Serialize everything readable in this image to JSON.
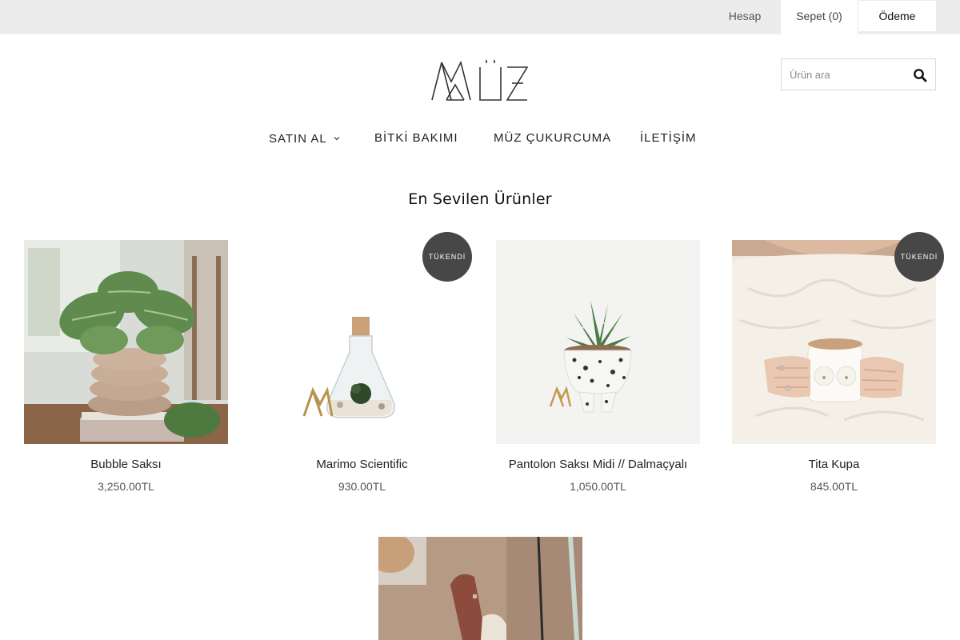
{
  "topbar": {
    "account": "Hesap",
    "cart": "Sepet (0)",
    "checkout": "Ödeme"
  },
  "logo": {
    "text": "MÜZ"
  },
  "search": {
    "placeholder": "Ürün ara",
    "value": ""
  },
  "nav": {
    "items": [
      {
        "label": "SATIN AL",
        "has_dropdown": true
      },
      {
        "label": "BİTKİ BAKIMI"
      },
      {
        "label": "MÜZ ÇUKURCUMA"
      },
      {
        "label": "İLETİŞİM"
      }
    ]
  },
  "section": {
    "title": "En Sevilen Ürünler"
  },
  "products": [
    {
      "name": "Bubble Saksı",
      "price": "3,250.00TL",
      "badge": ""
    },
    {
      "name": "Marimo Scientific",
      "price": "930.00TL",
      "badge": "TÜKENDİ"
    },
    {
      "name": "Pantolon Saksı Midi // Dalmaçyalı",
      "price": "1,050.00TL",
      "badge": ""
    },
    {
      "name": "Tita Kupa",
      "price": "845.00TL",
      "badge": "TÜKENDİ"
    },
    {
      "name": "",
      "price": "",
      "badge": ""
    }
  ],
  "colors": {
    "topbar_bg": "#ececec",
    "badge_bg": "#474747",
    "text": "#222222"
  }
}
